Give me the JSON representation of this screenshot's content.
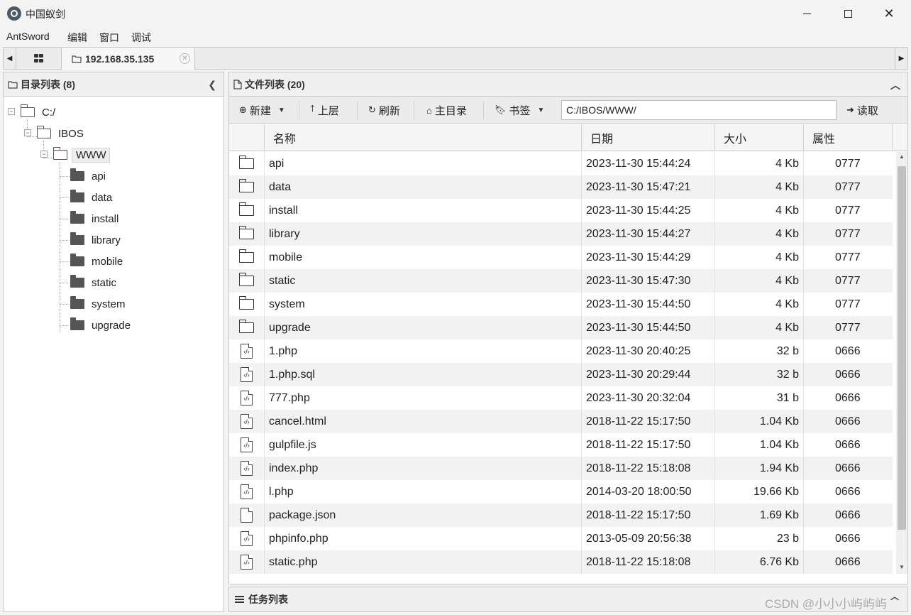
{
  "window": {
    "title": "中国蚁剑"
  },
  "menu": [
    "AntSword",
    "编辑",
    "窗口",
    "调试"
  ],
  "tabs": {
    "active_label": "192.168.35.135"
  },
  "left_panel": {
    "title": "目录列表 (8)",
    "tree": {
      "root": "C:/",
      "level1": "IBOS",
      "level2": "WWW",
      "children": [
        "api",
        "data",
        "install",
        "library",
        "mobile",
        "static",
        "system",
        "upgrade"
      ]
    }
  },
  "right_panel": {
    "title": "文件列表 (20)",
    "toolbar": {
      "new_label": "新建",
      "up_label": "上层",
      "refresh_label": "刷新",
      "home_label": "主目录",
      "bookmark_label": "书签",
      "path_value": "C:/IBOS/WWW/",
      "read_label": "读取"
    },
    "columns": [
      "名称",
      "日期",
      "大小",
      "属性"
    ],
    "files": [
      {
        "type": "folder",
        "name": "api",
        "date": "2023-11-30 15:44:24",
        "size": "4 Kb",
        "attr": "0777"
      },
      {
        "type": "folder",
        "name": "data",
        "date": "2023-11-30 15:47:21",
        "size": "4 Kb",
        "attr": "0777"
      },
      {
        "type": "folder",
        "name": "install",
        "date": "2023-11-30 15:44:25",
        "size": "4 Kb",
        "attr": "0777"
      },
      {
        "type": "folder",
        "name": "library",
        "date": "2023-11-30 15:44:27",
        "size": "4 Kb",
        "attr": "0777"
      },
      {
        "type": "folder",
        "name": "mobile",
        "date": "2023-11-30 15:44:29",
        "size": "4 Kb",
        "attr": "0777"
      },
      {
        "type": "folder",
        "name": "static",
        "date": "2023-11-30 15:47:30",
        "size": "4 Kb",
        "attr": "0777"
      },
      {
        "type": "folder",
        "name": "system",
        "date": "2023-11-30 15:44:50",
        "size": "4 Kb",
        "attr": "0777"
      },
      {
        "type": "folder",
        "name": "upgrade",
        "date": "2023-11-30 15:44:50",
        "size": "4 Kb",
        "attr": "0777"
      },
      {
        "type": "code",
        "name": "1.php",
        "date": "2023-11-30 20:40:25",
        "size": "32 b",
        "attr": "0666"
      },
      {
        "type": "code",
        "name": "1.php.sql",
        "date": "2023-11-30 20:29:44",
        "size": "32 b",
        "attr": "0666"
      },
      {
        "type": "code",
        "name": "777.php",
        "date": "2023-11-30 20:32:04",
        "size": "31 b",
        "attr": "0666"
      },
      {
        "type": "code",
        "name": "cancel.html",
        "date": "2018-11-22 15:17:50",
        "size": "1.04 Kb",
        "attr": "0666"
      },
      {
        "type": "code",
        "name": "gulpfile.js",
        "date": "2018-11-22 15:17:50",
        "size": "1.04 Kb",
        "attr": "0666"
      },
      {
        "type": "code",
        "name": "index.php",
        "date": "2018-11-22 15:18:08",
        "size": "1.94 Kb",
        "attr": "0666"
      },
      {
        "type": "code",
        "name": "l.php",
        "date": "2014-03-20 18:00:50",
        "size": "19.66 Kb",
        "attr": "0666"
      },
      {
        "type": "file",
        "name": "package.json",
        "date": "2018-11-22 15:17:50",
        "size": "1.69 Kb",
        "attr": "0666"
      },
      {
        "type": "code",
        "name": "phpinfo.php",
        "date": "2013-05-09 20:56:38",
        "size": "23 b",
        "attr": "0666"
      },
      {
        "type": "code",
        "name": "static.php",
        "date": "2018-11-22 15:18:08",
        "size": "6.76 Kb",
        "attr": "0666"
      }
    ]
  },
  "task_panel": {
    "title": "任务列表"
  },
  "watermark": "CSDN @小小小屿屿屿"
}
